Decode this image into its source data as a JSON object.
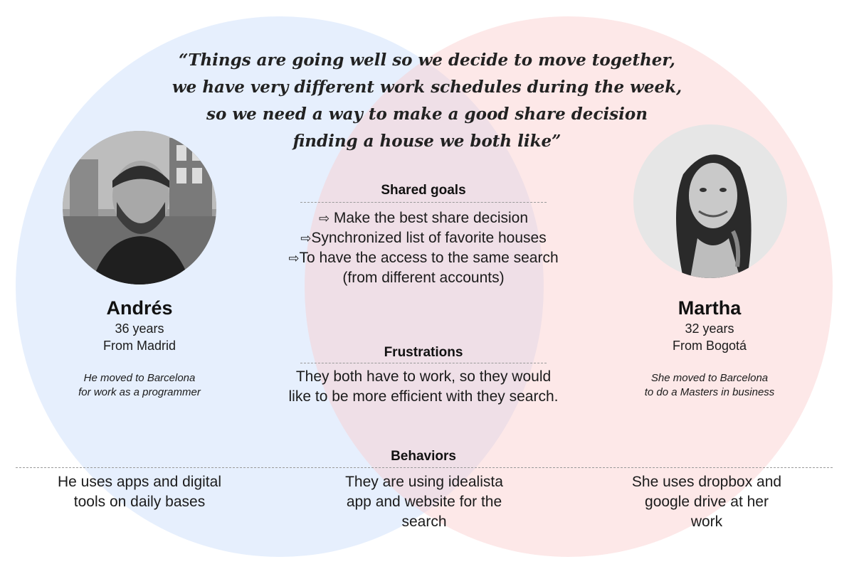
{
  "quote": {
    "line1": "“Things are going well so we decide to move together,",
    "line2": "we have very different work schedules during the week,",
    "line3": "so we need a way to make a good share decision",
    "line4": "finding a house we both like”"
  },
  "personas": {
    "left": {
      "name": "Andrés",
      "age": "36 years",
      "origin": "From Madrid",
      "bio_line1": "He moved to Barcelona",
      "bio_line2": "for work as a programmer",
      "behavior_line1": "He uses apps and digital",
      "behavior_line2": "tools on daily bases"
    },
    "right": {
      "name": "Martha",
      "age": "32 years",
      "origin": "From Bogotá",
      "bio_line1": "She moved to Barcelona",
      "bio_line2": "to do a Masters in business",
      "behavior_line1": "She uses dropbox and",
      "behavior_line2": "google drive at her",
      "behavior_line3": "work"
    }
  },
  "shared_goals": {
    "title": "Shared goals",
    "arrow_icon": "⇨",
    "item1": " Make the best share decision",
    "item2": "Synchronized list of favorite houses",
    "item3": "To have the access to the same search",
    "item3_cont": "(from different accounts)"
  },
  "frustrations": {
    "title": "Frustrations",
    "line1": "They both have to work, so they would",
    "line2": "like to be more efficient with they search."
  },
  "behaviors": {
    "title": "Behaviors",
    "center_line1": "They are using idealista",
    "center_line2": "app and website for the",
    "center_line3": "search"
  },
  "colors": {
    "left_circle": "#c7dbfa",
    "right_circle": "#facdcd",
    "divider": "#9a9a9a"
  }
}
